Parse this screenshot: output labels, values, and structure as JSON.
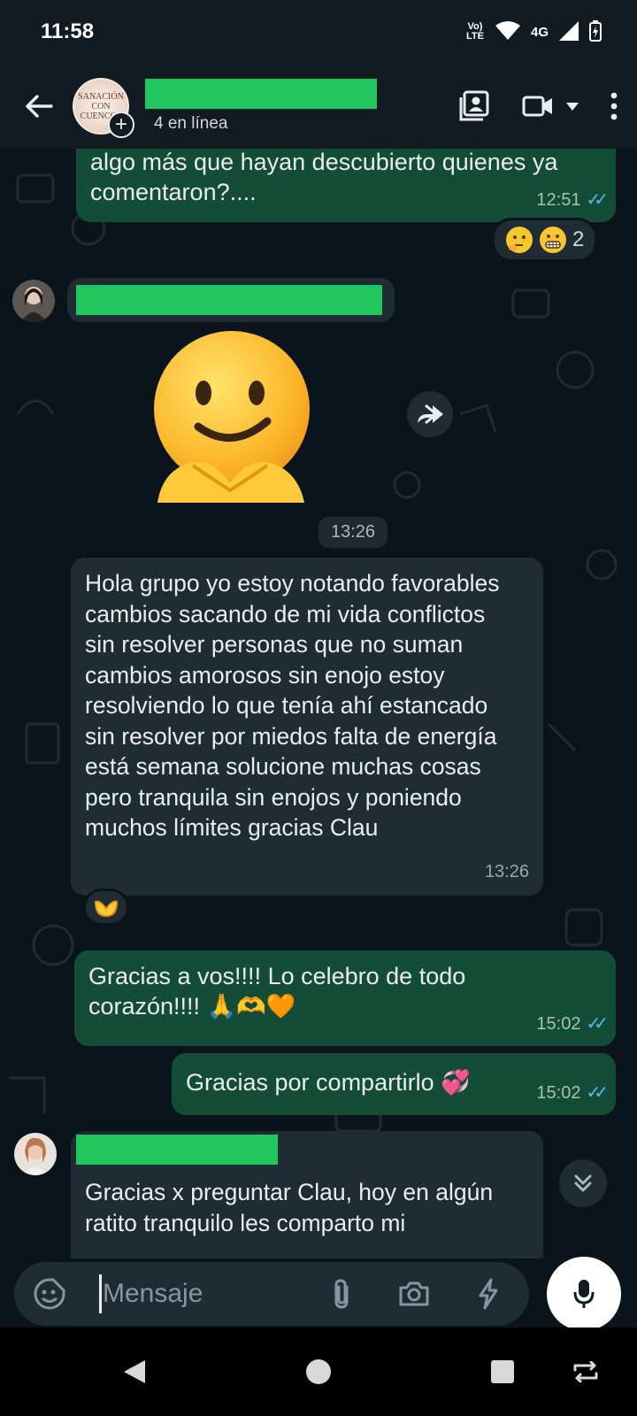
{
  "status_bar": {
    "time": "11:58",
    "lte": "Vo) LTE",
    "network": "4G"
  },
  "header": {
    "avatar_text": "SANACIÓN CON CUENCOS",
    "subtitle": "4 en línea"
  },
  "messages": [
    {
      "type": "out",
      "text": "algo más que hayan descubierto quienes ya comentaron?....",
      "time": "12:51",
      "reaction_count": "2"
    },
    {
      "type": "sticker",
      "time": "13:26"
    },
    {
      "type": "in",
      "text": "Hola grupo yo estoy notando favorables cambios sacando de mi vida conflictos sin resolver personas que no suman cambios amorosos sin enojo estoy resolviendo lo que tenía ahí estancado sin resolver por miedos falta de energía está semana solucione muchas cosas pero tranquila sin enojos y poniendo muchos límites gracias Clau",
      "time": "13:26"
    },
    {
      "type": "out",
      "text": "Gracias a vos!!!! Lo celebro de todo corazón!!!! 🙏🫶🧡",
      "time": "15:02"
    },
    {
      "type": "out",
      "text": "Gracias por compartirlo 💞",
      "time": "15:02"
    },
    {
      "type": "in",
      "text": "Gracias x preguntar Clau, hoy en algún ratito tranquilo les comparto mi"
    }
  ],
  "composer": {
    "placeholder": "Mensaje"
  },
  "colors": {
    "accent_green": "#22c55e",
    "outgoing_bubble": "#144d37",
    "incoming_bubble": "#202c33",
    "ticks": "#53bdeb"
  }
}
